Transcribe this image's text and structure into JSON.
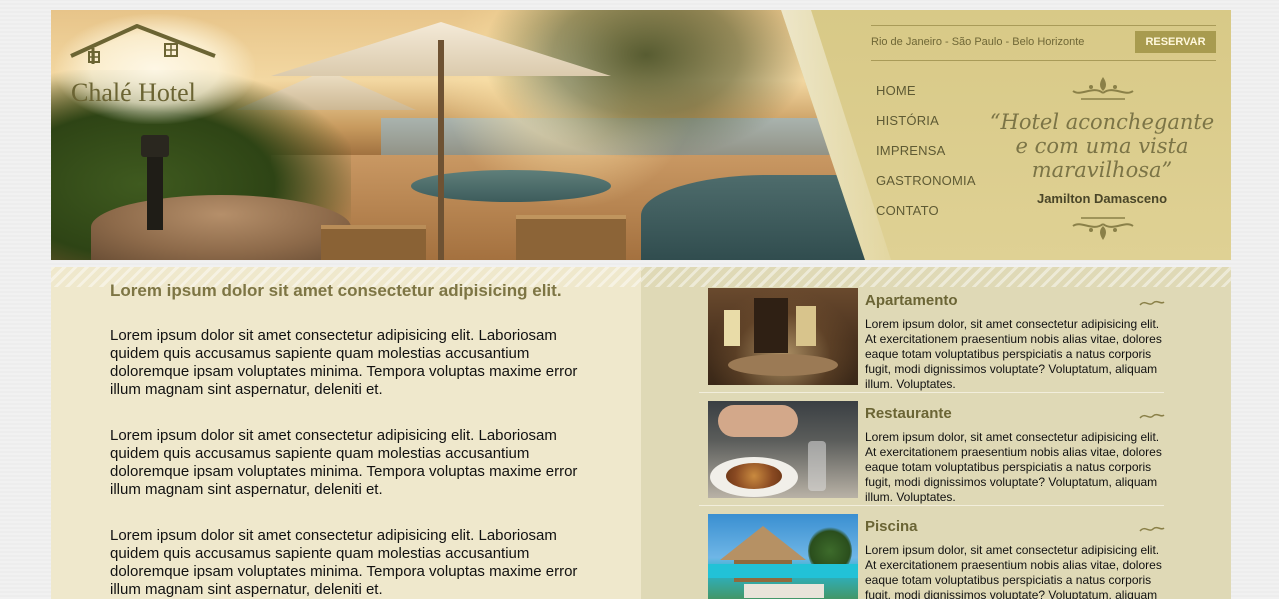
{
  "brand": {
    "name": "Chalé Hotel",
    "logo_icon": "house-roof-icon"
  },
  "header": {
    "cities": "Rio de Janeiro - São Paulo - Belo Horizonte",
    "reserve_label": "RESERVAR",
    "nav": [
      {
        "label": "HOME"
      },
      {
        "label": "HISTÓRIA"
      },
      {
        "label": "IMPRENSA"
      },
      {
        "label": "GASTRONOMIA"
      },
      {
        "label": "CONTATO"
      }
    ],
    "quote": "“Hotel aconchegante e com uma vista maravilhosa”",
    "quote_author": "Jamilton Damasceno"
  },
  "main": {
    "headline": "Lorem ipsum dolor sit amet consectetur adipisicing elit.",
    "paragraphs": [
      "Lorem ipsum dolor sit amet consectetur adipisicing elit. Laboriosam quidem quis accusamus sapiente quam molestias accusantium doloremque ipsam voluptates minima. Tempora voluptas maxime error illum magnam sint aspernatur, deleniti et.",
      "Lorem ipsum dolor sit amet consectetur adipisicing elit. Laboriosam quidem quis accusamus sapiente quam molestias accusantium doloremque ipsam voluptates minima. Tempora voluptas maxime error illum magnam sint aspernatur, deleniti et.",
      "Lorem ipsum dolor sit amet consectetur adipisicing elit. Laboriosam quidem quis accusamus sapiente quam molestias accusantium doloremque ipsam voluptates minima. Tempora voluptas maxime error illum magnam sint aspernatur, deleniti et."
    ]
  },
  "sidebar": {
    "cards": [
      {
        "title": "Apartamento",
        "description": "Lorem ipsum dolor, sit amet consectetur adipisicing elit. At exercitationem praesentium nobis alias vitae, dolores eaque totam voluptatibus perspiciatis a natus corporis fugit, modi dignissimos voluptate? Voluptatum, aliquam illum. Voluptates."
      },
      {
        "title": "Restaurante",
        "description": "Lorem ipsum dolor, sit amet consectetur adipisicing elit. At exercitationem praesentium nobis alias vitae, dolores eaque totam voluptatibus perspiciatis a natus corporis fugit, modi dignissimos voluptate? Voluptatum, aliquam illum. Voluptates."
      },
      {
        "title": "Piscina",
        "description": "Lorem ipsum dolor, sit amet consectetur adipisicing elit. At exercitationem praesentium nobis alias vitae, dolores eaque totam voluptatibus perspiciatis a natus corporis fugit, modi dignissimos voluptate? Voluptatum, aliquam illum. Voluptates."
      }
    ]
  },
  "colors": {
    "gold_panel": "#d8c987",
    "accent_olive": "#7d7544",
    "button_bg": "#a89b4f",
    "content_left_bg": "#efe8cc",
    "content_right_bg": "#dfd9b6"
  }
}
